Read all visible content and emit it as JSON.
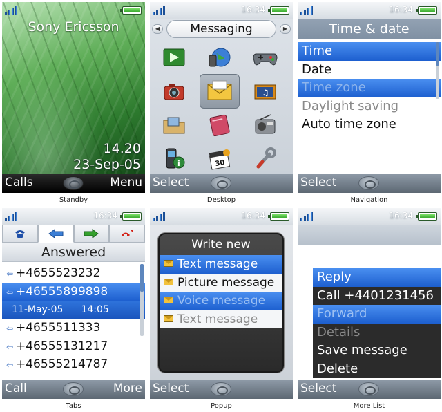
{
  "status": {
    "time": "16:34"
  },
  "panels": {
    "standby": {
      "caption": "Standby",
      "brand": "Sony Ericsson",
      "time": "14.20",
      "date": "23-Sep-05",
      "softkey_left": "Calls",
      "softkey_right": "Menu"
    },
    "desktop": {
      "caption": "Desktop",
      "title": "Messaging",
      "softkey_left": "Select",
      "icons": [
        "media-icon",
        "internet-globe-icon",
        "games-controller-icon",
        "camera-icon",
        "messaging-envelope-icon",
        "music-player-icon",
        "file-manager-folder-icon",
        "contacts-book-icon",
        "radio-icon",
        "phone-info-icon",
        "calendar-organizer-icon",
        "settings-wrench-icon"
      ]
    },
    "navigation": {
      "caption": "Navigation",
      "title": "Time & date",
      "items": [
        "Time",
        "Date",
        "Time zone",
        "Daylight saving",
        "Auto time zone"
      ],
      "softkey_left": "Select"
    },
    "tabs": {
      "caption": "Tabs",
      "title": "Answered",
      "calls": [
        "+4655523232",
        "+46555899898",
        "+4655511333",
        "+46555131217",
        "+46555214787"
      ],
      "selected_date": "11-May-05",
      "selected_time": "14:05",
      "softkey_left": "Call",
      "softkey_right": "More"
    },
    "popup": {
      "caption": "Popup",
      "title": "Write new",
      "items": [
        "Text message",
        "Picture message",
        "Voice message",
        "Text message"
      ],
      "softkey_left": "Select"
    },
    "more_list": {
      "caption": "More List",
      "items": [
        "Reply",
        "Call +4401231456",
        "Forward",
        "Details",
        "Save message",
        "Delete"
      ],
      "softkey_left": "Select"
    }
  },
  "colors": {
    "selection": "#1d5fcf",
    "softkey_bar": "#6f7b87",
    "title_bar": "#8798aa"
  }
}
